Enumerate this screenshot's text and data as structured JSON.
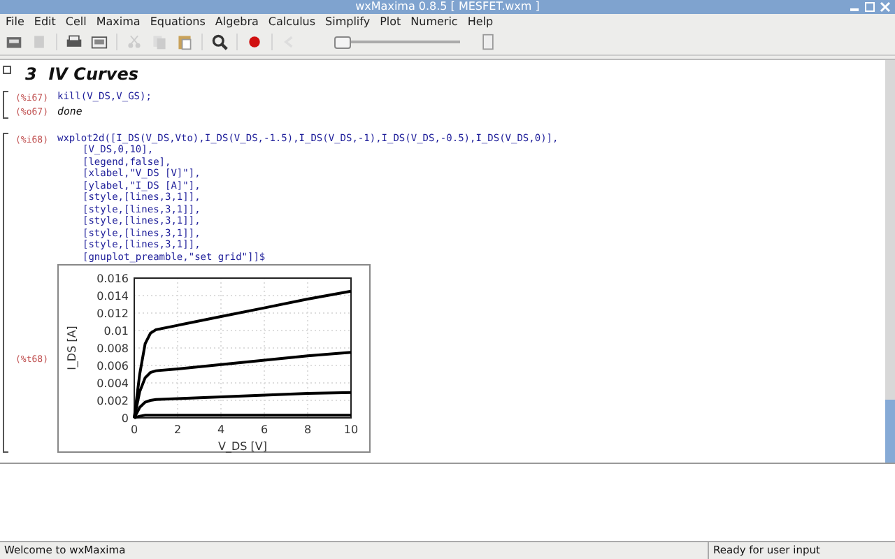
{
  "window": {
    "title": "wxMaxima 0.8.5  [ MESFET.wxm ]"
  },
  "menu": [
    "File",
    "Edit",
    "Cell",
    "Maxima",
    "Equations",
    "Algebra",
    "Calculus",
    "Simplify",
    "Plot",
    "Numeric",
    "Help"
  ],
  "toolbar": {
    "slider": {
      "level": 0
    }
  },
  "cells": [
    {
      "kind": "section",
      "number": "3",
      "title": "IV Curves"
    },
    {
      "kind": "io",
      "input_label": "(%i67)",
      "input": [
        "kill(V_DS,V_GS);"
      ],
      "output_label": "(%o67)",
      "output": "done"
    },
    {
      "kind": "plot",
      "input_label": "(%i68)",
      "input": [
        "wxplot2d([I_DS(V_DS,Vto),I_DS(V_DS,-1.5),I_DS(V_DS,-1),I_DS(V_DS,-0.5),I_DS(V_DS,0)],",
        "[V_DS,0,10],",
        "[legend,false],",
        "[xlabel,\"V_DS [V]\"],",
        "[ylabel,\"I_DS [A]\"],",
        "[style,[lines,3,1]],",
        "[style,[lines,3,1]],",
        "[style,[lines,3,1]],",
        "[style,[lines,3,1]],",
        "[style,[lines,3,1]],",
        "[gnuplot_preamble,\"set grid\"]]$"
      ],
      "output_label": "(%t68)",
      "chart_data": {
        "type": "line",
        "xlabel": "V_DS [V]",
        "ylabel": "I_DS [A]",
        "x": [
          0,
          0.25,
          0.5,
          0.75,
          1,
          2,
          4,
          6,
          8,
          10
        ],
        "series": [
          {
            "color": "#000000",
            "values": [
              0,
              0.005,
              0.0085,
              0.0097,
              0.0101,
              0.0106,
              0.0116,
              0.0126,
              0.0136,
              0.0145
            ]
          },
          {
            "color": "#000000",
            "values": [
              0,
              0.003,
              0.0046,
              0.0052,
              0.0054,
              0.0056,
              0.0061,
              0.0066,
              0.0071,
              0.0075
            ]
          },
          {
            "color": "#000000",
            "values": [
              0,
              0.0012,
              0.0018,
              0.002,
              0.0021,
              0.0022,
              0.0024,
              0.0026,
              0.0028,
              0.0029
            ]
          },
          {
            "color": "#000000",
            "values": [
              0,
              0.0002,
              0.0003,
              0.0003,
              0.0003,
              0.0003,
              0.0003,
              0.0003,
              0.0003,
              0.0003
            ]
          }
        ],
        "grid": true,
        "xlim": [
          0,
          10
        ],
        "ylim": [
          0,
          0.016
        ],
        "xticks": [
          0,
          2,
          4,
          6,
          8,
          10
        ],
        "yticks": [
          0,
          0.002,
          0.004,
          0.006,
          0.008,
          0.01,
          0.012,
          0.014,
          0.016
        ]
      }
    }
  ],
  "status_bar": {
    "left": "Welcome to wxMaxima",
    "right": "Ready for user input"
  }
}
